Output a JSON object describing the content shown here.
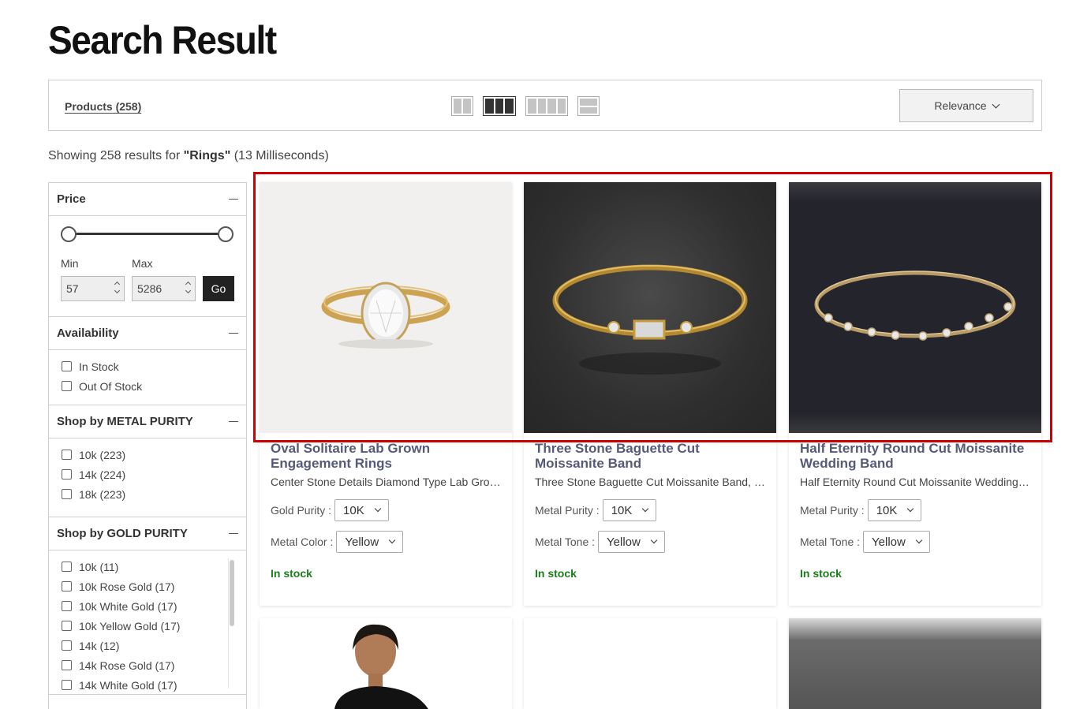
{
  "page": {
    "title": "Search Result"
  },
  "toolbar": {
    "products_tab": "Products (258)",
    "sort_label": "Relevance"
  },
  "summary": {
    "prefix": "Showing 258 results for ",
    "query": "\"Rings\"",
    "suffix": " (13 Milliseconds)"
  },
  "filters": {
    "price": {
      "title": "Price",
      "min_label": "Min",
      "max_label": "Max",
      "min_value": "57",
      "max_value": "5286",
      "go_label": "Go"
    },
    "availability": {
      "title": "Availability",
      "options": [
        "In Stock",
        "Out Of Stock"
      ]
    },
    "metal_purity": {
      "title": "Shop by METAL PURITY",
      "options": [
        "10k (223)",
        "14k (224)",
        "18k (223)"
      ]
    },
    "gold_purity": {
      "title": "Shop by GOLD PURITY",
      "options": [
        "10k (11)",
        "10k Rose Gold (17)",
        "10k White Gold (17)",
        "10k Yellow Gold (17)",
        "14k (12)",
        "14k Rose Gold (17)",
        "14k White Gold (17)"
      ]
    }
  },
  "products": [
    {
      "title": "Oval Solitaire Lab Grown Engagement Rings",
      "description": "Center Stone Details Diamond Type Lab Grown Diamond",
      "option1_label": "Gold Purity :",
      "option1_value": "10K",
      "option2_label": "Metal Color :",
      "option2_value": "Yellow",
      "stock": "In stock"
    },
    {
      "title": "Three Stone Baguette Cut Moissanite Band",
      "description": "Three Stone Baguette Cut Moissanite Band, a timeless",
      "option1_label": "Metal Purity :",
      "option1_value": "10K",
      "option2_label": "Metal Tone :",
      "option2_value": "Yellow",
      "stock": "In stock"
    },
    {
      "title": "Half Eternity Round Cut Moissanite Wedding Band",
      "description": "Half Eternity Round Cut Moissanite Wedding Band for her",
      "option1_label": "Metal Purity :",
      "option1_value": "10K",
      "option2_label": "Metal Tone :",
      "option2_value": "Yellow",
      "stock": "In stock"
    }
  ],
  "colors": {
    "accent_title": "#555a78",
    "in_stock": "#1b7d1b",
    "highlight": "#d10000"
  }
}
